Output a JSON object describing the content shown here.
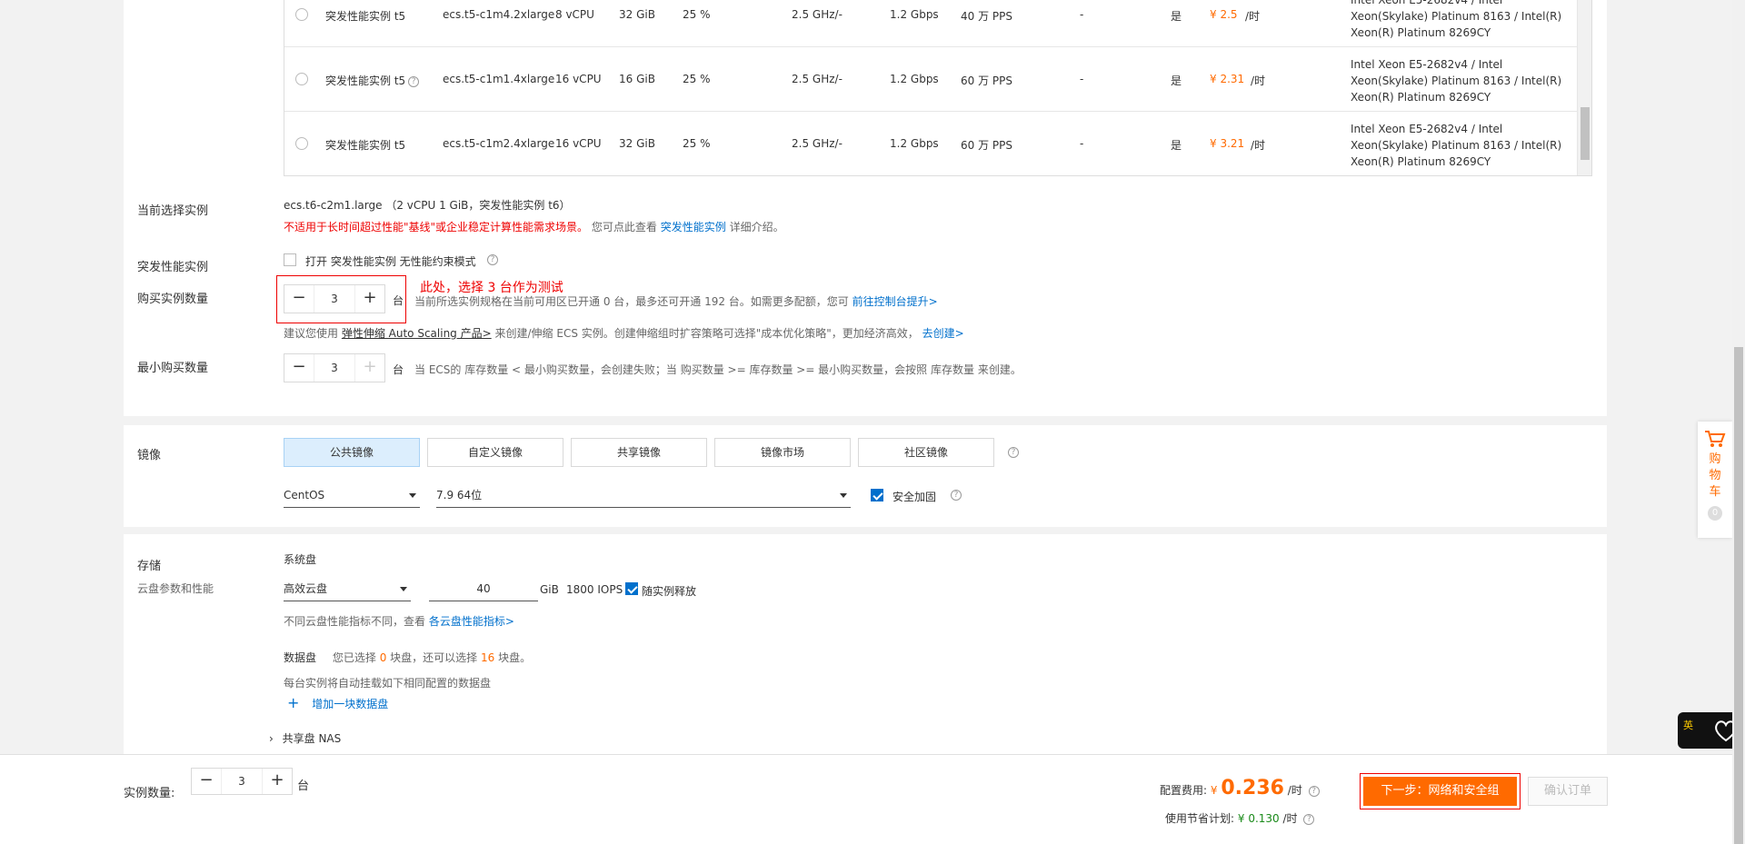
{
  "table": {
    "rows": [
      {
        "family": "突发性能实例 t5",
        "spec": "ecs.t5-c1m4.2xlarge",
        "vcpu": "8 vCPU",
        "memory": "32 GiB",
        "baseline": "25 %",
        "clock": "2.5 GHz/-",
        "bandwidth": "1.2 Gbps",
        "pps": "40 万 PPS",
        "ipv6": "-",
        "support": "是",
        "price": "¥ 2.5",
        "unit": "/时",
        "cpu": "Intel Xeon E5-2682v4 / Intel Xeon(Skylake) Platinum 8163 / Intel(R) Xeon(R) Platinum 8269CY",
        "help": false
      },
      {
        "family": "突发性能实例 t5",
        "spec": "ecs.t5-c1m1.4xlarge",
        "vcpu": "16 vCPU",
        "memory": "16 GiB",
        "baseline": "25 %",
        "clock": "2.5 GHz/-",
        "bandwidth": "1.2 Gbps",
        "pps": "60 万 PPS",
        "ipv6": "-",
        "support": "是",
        "price": "¥ 2.31",
        "unit": "/时",
        "cpu": "Intel Xeon E5-2682v4 / Intel Xeon(Skylake) Platinum 8163 / Intel(R) Xeon(R) Platinum 8269CY",
        "help": true
      },
      {
        "family": "突发性能实例 t5",
        "spec": "ecs.t5-c1m2.4xlarge",
        "vcpu": "16 vCPU",
        "memory": "32 GiB",
        "baseline": "25 %",
        "clock": "2.5 GHz/-",
        "bandwidth": "1.2 Gbps",
        "pps": "60 万 PPS",
        "ipv6": "-",
        "support": "是",
        "price": "¥ 3.21",
        "unit": "/时",
        "cpu": "Intel Xeon E5-2682v4 / Intel Xeon(Skylake) Platinum 8163 / Intel(R) Xeon(R) Platinum 8269CY",
        "help": false
      }
    ]
  },
  "selected": {
    "label": "当前选择实例",
    "spec": "ecs.t6-c2m1.large",
    "detail": "（2 vCPU 1 GiB，突发性能实例 t6）",
    "warning": "不适用于长时间超过性能\"基线\"或企业稳定计算性能需求场景。",
    "note_prefix": "您可点此查看",
    "note_link": "突发性能实例",
    "note_suffix": "详细介绍。"
  },
  "burst": {
    "label": "突发性能实例",
    "checkbox_text": "打开 突发性能实例 无性能约束模式"
  },
  "quantity": {
    "label": "购买实例数量",
    "value": "3",
    "unit": "台",
    "annotation": "此处，选择 3 台作为测试",
    "info": "当前所选实例规格在当前可用区已开通 0 台，最多还可开通 192 台。如需更多配额，您可",
    "info_link": "前往控制台提升>",
    "hint_prefix": "建议您使用",
    "hint_underline": "弹性伸缩 Auto Scaling 产品>",
    "hint_mid": "来创建/伸缩 ECS 实例。创建伸缩组时扩容策略可选择\"成本优化策略\"，更加经济高效，",
    "hint_link": "去创建>"
  },
  "min_quantity": {
    "label": "最小购买数量",
    "value": "3",
    "unit": "台",
    "info": "当 ECS的 库存数量 < 最小购买数量，会创建失败；当 购买数量 >= 库存数量 >= 最小购买数量，会按照 库存数量 来创建。"
  },
  "image": {
    "label": "镜像",
    "tabs": [
      "公共镜像",
      "自定义镜像",
      "共享镜像",
      "镜像市场",
      "社区镜像"
    ],
    "os": "CentOS",
    "version": "7.9 64位",
    "security": "安全加固"
  },
  "storage": {
    "label": "存储",
    "sublabel": "云盘参数和性能",
    "system_disk": "系统盘",
    "disk_type": "高效云盘",
    "size": "40",
    "size_unit": "GiB",
    "iops": "1800 IOPS",
    "release": "随实例释放",
    "perf_note": "不同云盘性能指标不同，查看",
    "perf_link": "各云盘性能指标>",
    "data_disk": "数据盘",
    "data_selected_prefix": "您已选择",
    "data_selected": "0",
    "data_selected_mid": "块盘，还可以选择",
    "data_remaining": "16",
    "data_selected_suffix": "块盘。",
    "data_note": "每台实例将自动挂载如下相同配置的数据盘",
    "add_disk": "增加一块数据盘",
    "nas": "共享盘 NAS"
  },
  "cart": {
    "chars": [
      "购",
      "物",
      "车"
    ],
    "count": "0"
  },
  "footer": {
    "qty_label": "实例数量:",
    "qty_value": "3",
    "qty_unit": "台",
    "fee_label": "配置费用:",
    "fee_currency": "¥",
    "fee_value": "0.236",
    "fee_unit": "/时",
    "save_label": "使用节省计划:",
    "save_value": "¥ 0.130",
    "save_unit": "/时",
    "next_button": "下一步：网络和安全组",
    "confirm_button": "确认订单"
  },
  "widget": {
    "char": "英"
  },
  "colors": {
    "accent": "#ff6a00",
    "link": "#0070cc",
    "annotation": "#e00000"
  }
}
